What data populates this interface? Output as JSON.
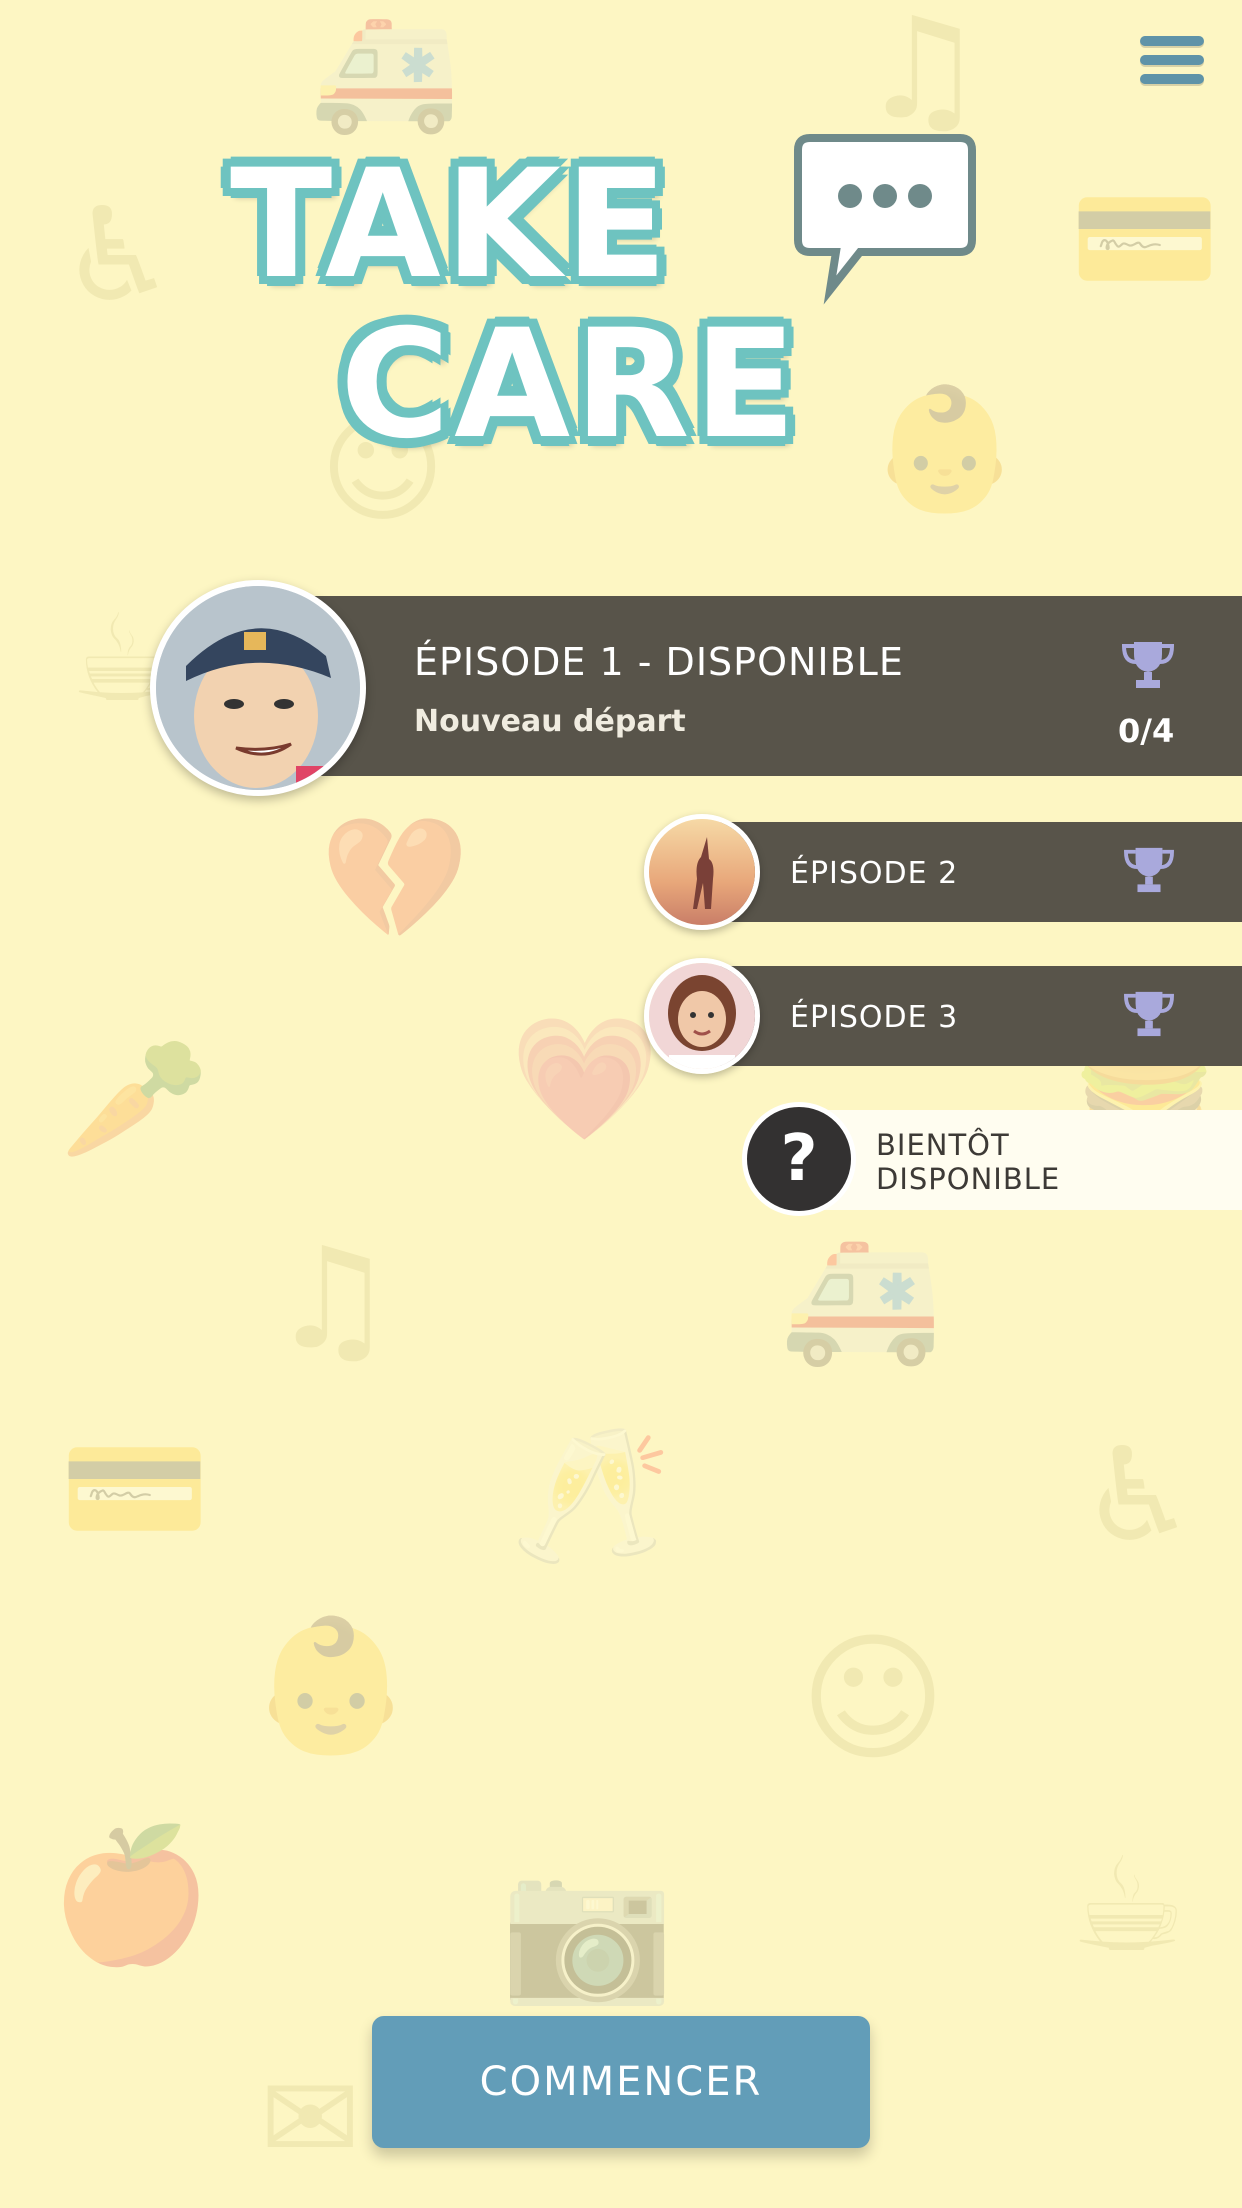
{
  "app": {
    "logo_line1": "TAKE",
    "logo_line2": "CARE",
    "menu_icon": "hamburger-menu-icon"
  },
  "episodes": [
    {
      "title": "ÉPISODE 1 - DISPONIBLE",
      "subtitle": "Nouveau départ",
      "score": "0/4",
      "icon": "trophy-icon",
      "avatar": "boy-with-cap"
    },
    {
      "title": "ÉPISODE 2",
      "icon": "trophy-icon",
      "avatar": "girl-sunset-silhouette"
    },
    {
      "title": "ÉPISODE 3",
      "icon": "trophy-icon",
      "avatar": "smiling-woman"
    }
  ],
  "coming_soon": {
    "line1": "BIENTÔT",
    "line2": "DISPONIBLE",
    "icon": "question-mark-icon"
  },
  "start_button": "COMMENCER",
  "colors": {
    "background": "#fdf6c3",
    "bar": "#58544a",
    "accent_teal": "#6ec3c0",
    "button": "#629db8",
    "trophy": "#a9a9dc"
  }
}
